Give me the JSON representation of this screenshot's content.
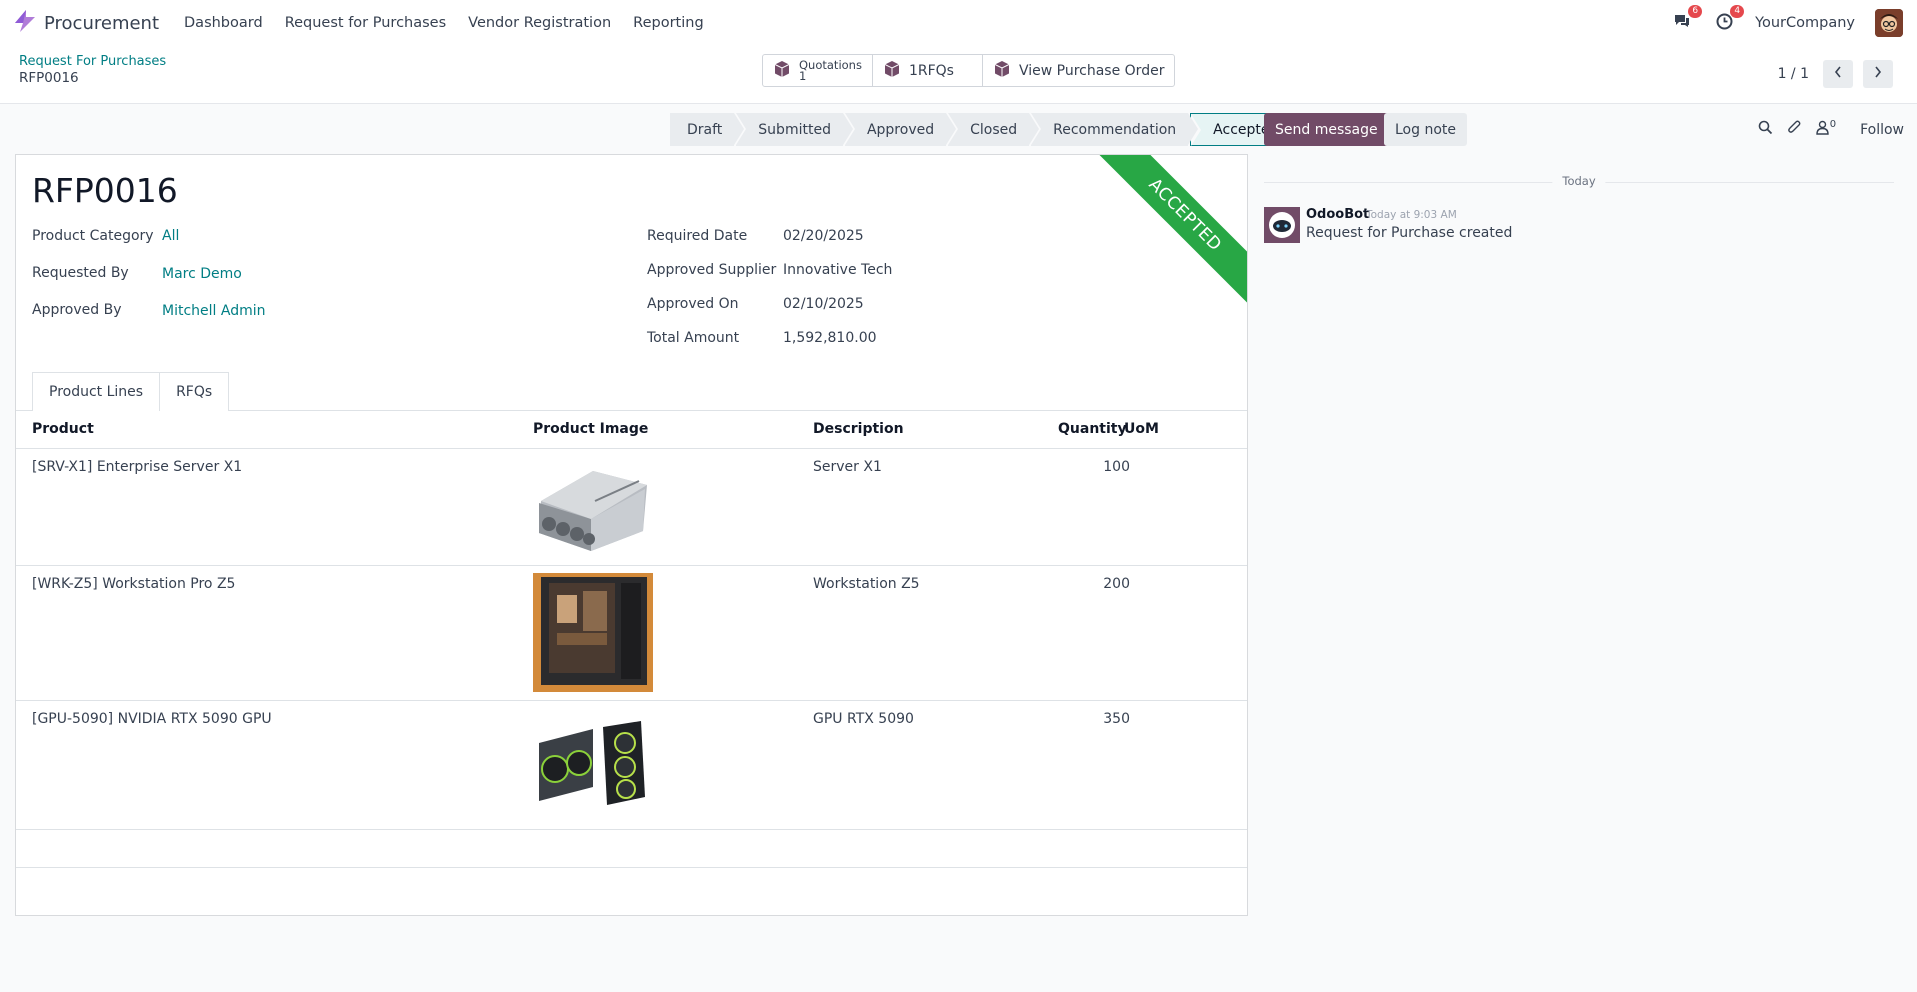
{
  "app": {
    "name": "Procurement",
    "menu": [
      "Dashboard",
      "Request for Purchases",
      "Vendor Registration",
      "Reporting"
    ],
    "messages_count": "6",
    "activities_count": "4",
    "company": "YourCompany"
  },
  "breadcrumb": {
    "parent": "Request For Purchases",
    "current": "RFP0016"
  },
  "smart_buttons": {
    "quotations_label": "Quotations",
    "quotations_count": "1",
    "rfqs_label": "1RFQs",
    "view_po_label": "View Purchase Order"
  },
  "pager": {
    "value": "1 / 1"
  },
  "statusbar": {
    "stages": [
      "Draft",
      "Submitted",
      "Approved",
      "Closed",
      "Recommendation",
      "Accepted"
    ],
    "active": "Accepted"
  },
  "form": {
    "title": "RFP0016",
    "ribbon": "ACCEPTED",
    "left_fields": [
      {
        "label": "Product Category",
        "value": "All"
      },
      {
        "label": "Requested By",
        "value": "Marc Demo"
      },
      {
        "label": "Approved By",
        "value": "Mitchell Admin"
      }
    ],
    "right_fields": [
      {
        "label": "Required Date",
        "value": "02/20/2025"
      },
      {
        "label": "Approved Supplier",
        "value": "Innovative Tech"
      },
      {
        "label": "Approved On",
        "value": "02/10/2025"
      },
      {
        "label": "Total Amount",
        "value": "1,592,810.00"
      }
    ],
    "tabs": [
      "Product Lines",
      "RFQs"
    ]
  },
  "table": {
    "headers": [
      "Product",
      "Product Image",
      "Description",
      "Quantity",
      "UoM"
    ],
    "rows": [
      {
        "product": "[SRV-X1] Enterprise Server X1",
        "image": "server-image",
        "description": "Server X1",
        "quantity": "100",
        "uom": ""
      },
      {
        "product": "[WRK-Z5] Workstation Pro Z5",
        "image": "workstation-image",
        "description": "Workstation Z5",
        "quantity": "200",
        "uom": ""
      },
      {
        "product": "[GPU-5090] NVIDIA RTX 5090 GPU",
        "image": "gpu-image",
        "description": "GPU RTX 5090",
        "quantity": "350",
        "uom": ""
      }
    ]
  },
  "chatter": {
    "send_message": "Send message",
    "log_note": "Log note",
    "followers_count": "0",
    "follow": "Follow",
    "date_separator": "Today",
    "message": {
      "author": "OdooBot",
      "time": "Today at 9:03 AM",
      "body": "Request for Purchase created"
    }
  },
  "colors": {
    "brand": "#714b67",
    "link": "#017e84",
    "ribbon": "#28a745",
    "badge": "#e5484d"
  }
}
